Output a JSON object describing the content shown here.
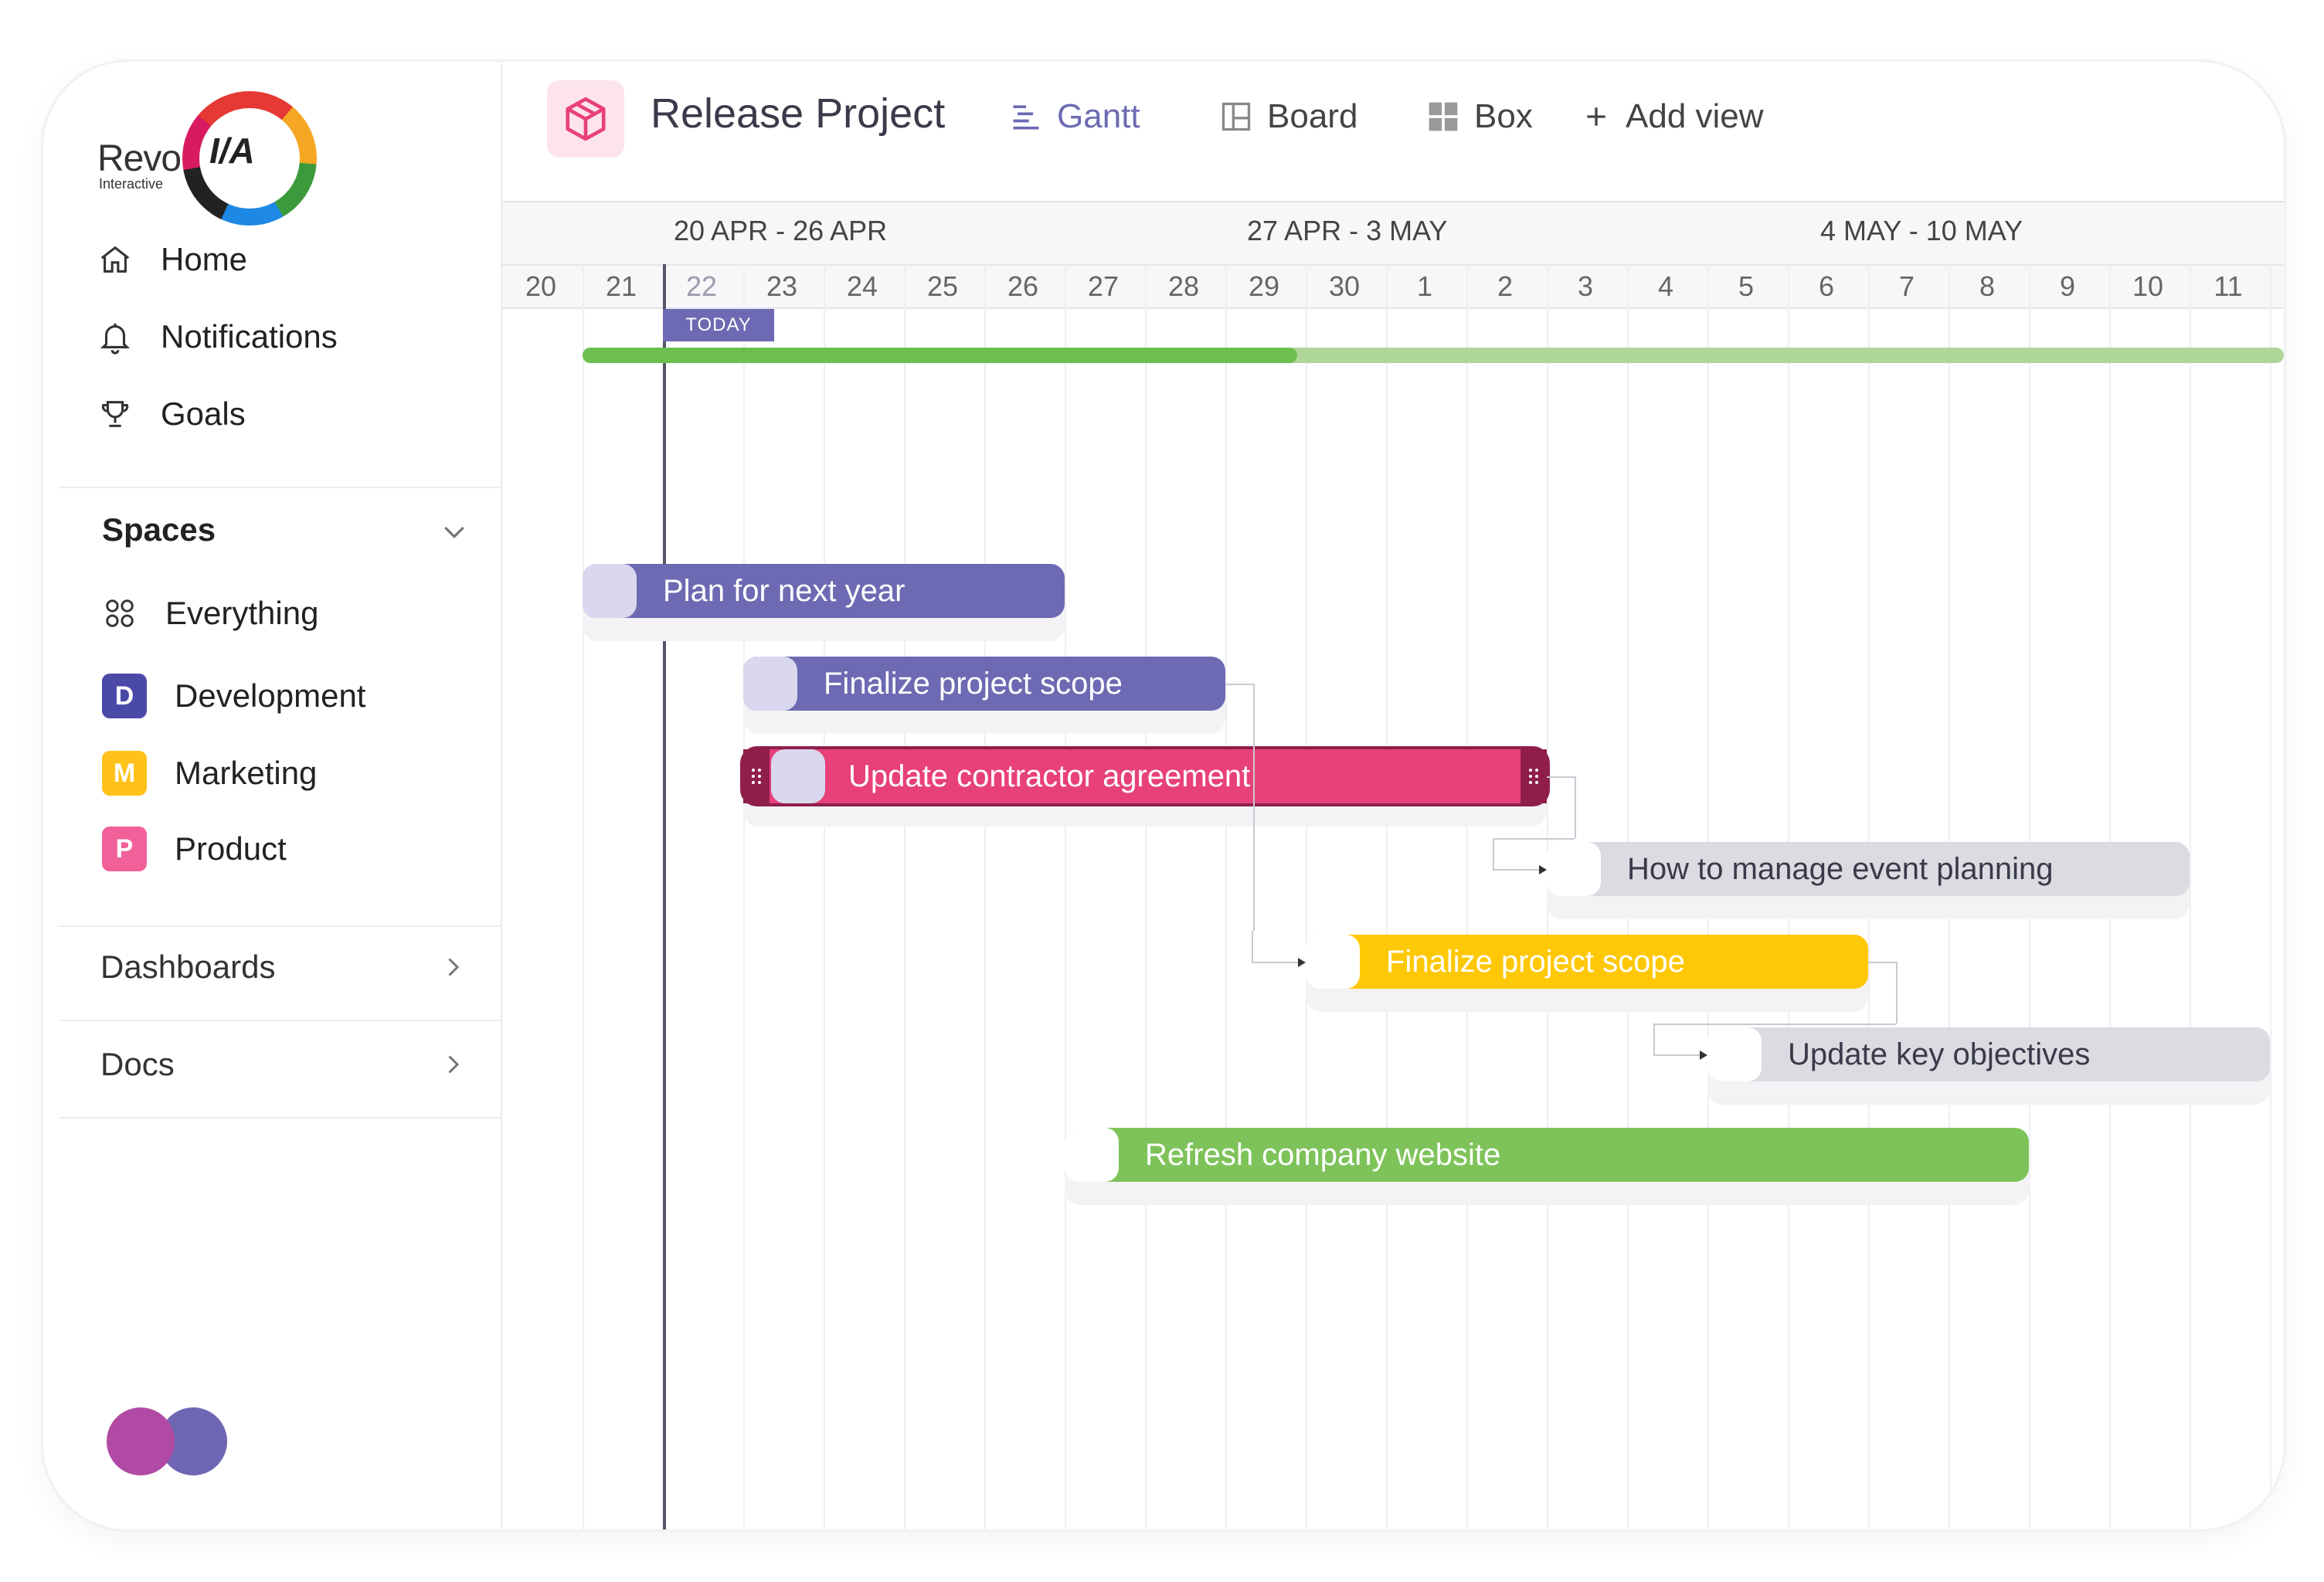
{
  "logo": {
    "brand": "Revo",
    "sub": "Interactive",
    "mark": "I/A"
  },
  "nav": [
    {
      "label": "Home",
      "icon": "home-icon"
    },
    {
      "label": "Notifications",
      "icon": "bell-icon"
    },
    {
      "label": "Goals",
      "icon": "trophy-icon"
    }
  ],
  "spaces": {
    "title": "Spaces",
    "items": [
      {
        "label": "Everything",
        "icon": "grid-icon"
      },
      {
        "label": "Development",
        "badge": "D",
        "color": "#4b49a8"
      },
      {
        "label": "Marketing",
        "badge": "M",
        "color": "#ffc21a"
      },
      {
        "label": "Product",
        "badge": "P",
        "color": "#f2609a"
      }
    ]
  },
  "sections": [
    {
      "label": "Dashboards"
    },
    {
      "label": "Docs"
    }
  ],
  "avatars": [
    {
      "color": "#b04aa4"
    },
    {
      "color": "#6f66b3"
    }
  ],
  "header": {
    "project_title": "Release Project",
    "project_icon": "cube-icon",
    "views": [
      {
        "label": "Gantt",
        "icon": "gantt-icon",
        "active": true
      },
      {
        "label": "Board",
        "icon": "board-icon",
        "active": false
      },
      {
        "label": "Box",
        "icon": "box-icon",
        "active": false
      },
      {
        "label": "Add view",
        "icon": "plus-icon",
        "active": false
      }
    ]
  },
  "gantt": {
    "weeks": [
      "20 APR - 26 APR",
      "27 APR - 3 MAY",
      "4 MAY - 10 MAY"
    ],
    "days": [
      "20",
      "21",
      "22",
      "23",
      "24",
      "25",
      "26",
      "27",
      "28",
      "29",
      "30",
      "1",
      "2",
      "3",
      "4",
      "5",
      "6",
      "7",
      "8",
      "9",
      "10",
      "11"
    ],
    "today_label": "TODAY",
    "today_day": "22",
    "overall_progress": 0.42,
    "tasks": [
      {
        "label": "Plan for next year",
        "start_day": "21",
        "end_day": "26",
        "color": "#6d6ab3",
        "text_color": "#ffffff"
      },
      {
        "label": "Finalize project scope",
        "start_day": "23",
        "end_day": "28",
        "color": "#6d6ab3",
        "text_color": "#ffffff"
      },
      {
        "label": "Update contractor agreement",
        "start_day": "23",
        "end_day": "2",
        "color": "#e8417a",
        "text_color": "#ffffff",
        "selected": true
      },
      {
        "label": "How to manage event planning",
        "start_day": "3",
        "end_day": "10",
        "color": "#dadce1",
        "text_color": "#3a3a4a"
      },
      {
        "label": "Finalize project scope",
        "start_day": "30",
        "end_day": "6",
        "color": "#ffc807",
        "text_color": "#ffffff"
      },
      {
        "label": "Update key objectives",
        "start_day": "5",
        "end_day": "11",
        "color": "#dadce1",
        "text_color": "#3a3a4a"
      },
      {
        "label": "Refresh company website",
        "start_day": "27",
        "end_day": "8",
        "color": "#7ec35a",
        "text_color": "#ffffff"
      }
    ]
  }
}
